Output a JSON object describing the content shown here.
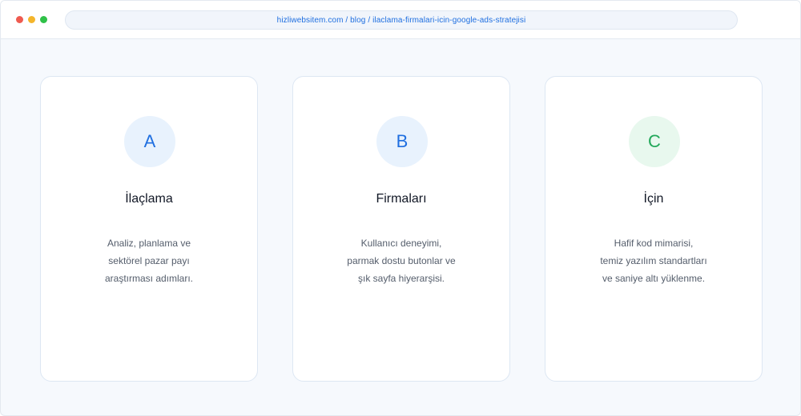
{
  "browser": {
    "url": "hizliwebsitem.com / blog / ilaclama-firmalari-icin-google-ads-stratejisi",
    "window_controls": [
      "close",
      "minimize",
      "zoom"
    ]
  },
  "cards": [
    {
      "badge_letter": "A",
      "badge_color": "#1f6fe0",
      "title": "İlaçlama",
      "description_lines": [
        "Analiz, planlama ve",
        "sektörel pazar payı",
        "araştırması adımları."
      ]
    },
    {
      "badge_letter": "B",
      "badge_color": "#1f6fe0",
      "title": "Firmaları",
      "description_lines": [
        "Kullanıcı deneyimi,",
        "parmak dostu butonlar ve",
        "şık sayfa hiyerarşisi."
      ]
    },
    {
      "badge_letter": "C",
      "badge_color": "#22a85a",
      "title": "İçin",
      "description_lines": [
        "Hafif kod mimarisi,",
        "temiz yazılım standartları",
        "ve saniye altı yüklenme."
      ]
    }
  ]
}
